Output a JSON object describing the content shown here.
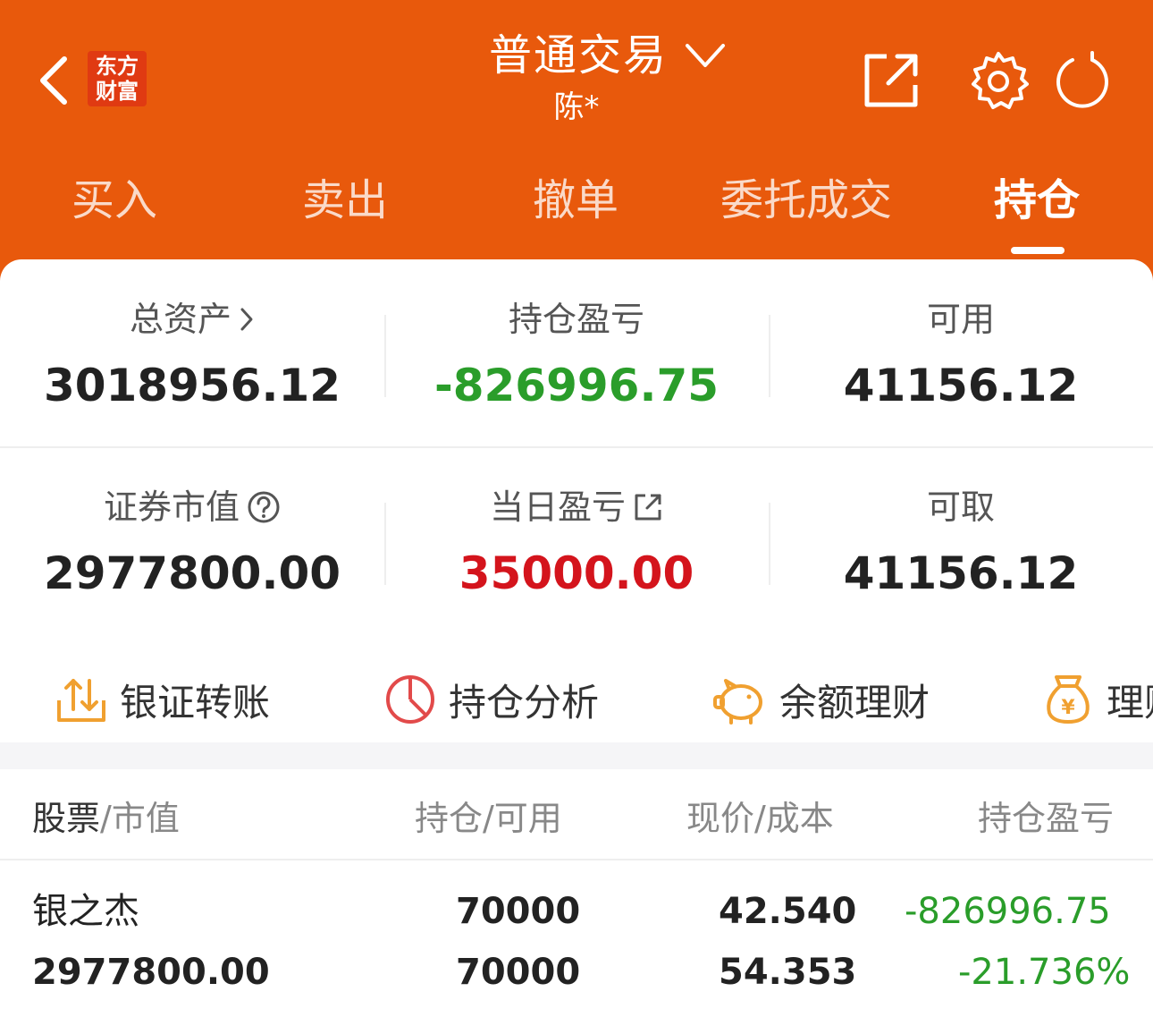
{
  "header": {
    "logo_line1": "东方",
    "logo_line2": "财富",
    "title": "普通交易",
    "account": "陈*",
    "icons": [
      "back-chevron-icon",
      "share-external-icon",
      "gear-icon",
      "refresh-icon",
      "chevron-down-icon"
    ]
  },
  "tabs": [
    {
      "label": "买入"
    },
    {
      "label": "卖出"
    },
    {
      "label": "撤单"
    },
    {
      "label": "委托成交"
    },
    {
      "label": "持仓",
      "active": true
    }
  ],
  "stats": {
    "total_assets": {
      "label": "总资产",
      "value": "3018956.12"
    },
    "position_pl": {
      "label": "持仓盈亏",
      "value": "-826996.75"
    },
    "available": {
      "label": "可用",
      "value": "41156.12"
    },
    "market_value": {
      "label": "证券市值",
      "value": "2977800.00"
    },
    "daily_pl": {
      "label": "当日盈亏",
      "value": "35000.00"
    },
    "withdrawable": {
      "label": "可取",
      "value": "41156.12"
    }
  },
  "quick_actions": [
    {
      "label": "银证转账",
      "icon": "transfer-icon"
    },
    {
      "label": "持仓分析",
      "icon": "pie-chart-icon"
    },
    {
      "label": "余额理财",
      "icon": "piggy-bank-icon"
    },
    {
      "label": "理财",
      "icon": "money-bag-icon"
    }
  ],
  "table": {
    "headers": {
      "col1_a": "股票",
      "col1_b": "/市值",
      "col2": "持仓/可用",
      "col3": "现价/成本",
      "col4": "持仓盈亏"
    },
    "rows": [
      {
        "name": "银之杰",
        "market_value": "2977800.00",
        "position": "70000",
        "available": "70000",
        "price": "42.540",
        "cost": "54.353",
        "pl": "-826996.75",
        "pl_pct": "-21.736%"
      }
    ]
  },
  "colors": {
    "brand": "#e8590c",
    "loss": "#2a9d2a",
    "gain": "#d4141c",
    "icon_orange": "#f0a030",
    "icon_red": "#e24a4a"
  }
}
